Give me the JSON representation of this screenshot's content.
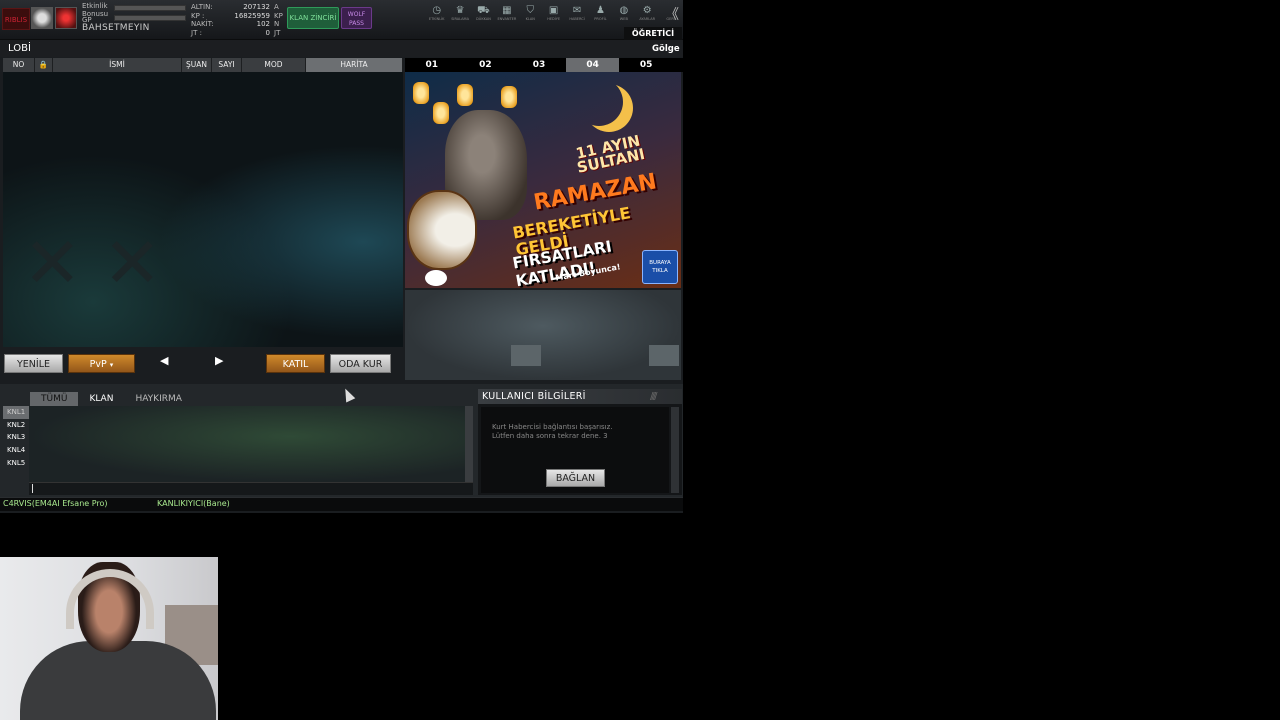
{
  "header": {
    "logo_text": "RIBLIS",
    "event_bonus": "Etkinlik Bonusu",
    "gp_label": "GP",
    "player_name": "BAHSETMEYIN",
    "currencies": [
      {
        "label": "ALTIN:",
        "value": "207132",
        "unit": "A"
      },
      {
        "label": "KP :",
        "value": "16825959",
        "unit": "KP"
      },
      {
        "label": "NAKİT:",
        "value": "102",
        "unit": "N"
      },
      {
        "label": "JT :",
        "value": "0",
        "unit": "JT"
      }
    ],
    "clan_chain_label": "KLAN ZİNCİRİ",
    "wolf_pass_label": "WOLF PASS",
    "top_icons": [
      {
        "name": "etkinlik",
        "glyph": "◷",
        "label": "ETKİNLİK"
      },
      {
        "name": "siralama",
        "glyph": "♛",
        "label": "SIRALAMA"
      },
      {
        "name": "dukkan",
        "glyph": "⛟",
        "label": "DÜKKAN"
      },
      {
        "name": "envanter",
        "glyph": "▦",
        "label": "ENVANTER"
      },
      {
        "name": "klan",
        "glyph": "⛉",
        "label": "KLAN"
      },
      {
        "name": "hediye",
        "glyph": "▣",
        "label": "HEDİYE"
      },
      {
        "name": "haberci",
        "glyph": "✉",
        "label": "HABERCİ"
      },
      {
        "name": "profil",
        "glyph": "♟",
        "label": "PROFİL"
      },
      {
        "name": "web",
        "glyph": "◍",
        "label": "WEB"
      },
      {
        "name": "ayarlar",
        "glyph": "⚙",
        "label": "AYARLAR"
      },
      {
        "name": "geri",
        "glyph": "",
        "label": "GERİ"
      }
    ],
    "back_glyph": "《",
    "tutorial_label": "ÖĞRETİCİ"
  },
  "lobby": {
    "title": "LOBİ",
    "shadow_label": "Gölge",
    "columns": [
      "NO",
      "🔒",
      "İSMİ",
      "ŞUAN",
      "SAYI",
      "MOD",
      "HARİTA"
    ],
    "refresh_label": "YENİLE",
    "mode_label": "PvP",
    "join_label": "KATIL",
    "create_room_label": "ODA KUR",
    "prev_glyph": "◀",
    "next_glyph": "▶"
  },
  "banner": {
    "tabs": [
      "01",
      "02",
      "03",
      "04",
      "05"
    ],
    "active_tab": 3,
    "line1": "11 AYIN",
    "line1b": "SULTANI",
    "line2": "RAMAZAN",
    "line3": "BEREKETİYLE GELDİ",
    "line4": "FIRSATLARI KATLADI!",
    "line5": "Mart Boyunca!",
    "click_label": "BURAYA TIKLA"
  },
  "chat": {
    "tabs": [
      "TÜMÜ",
      "KLAN",
      "HAYKIRMA"
    ],
    "channels": [
      "KNL1",
      "KNL2",
      "KNL3",
      "KNL4",
      "KNL5"
    ]
  },
  "user_info": {
    "title": "KULLANICI BİLGİLERİ",
    "message_line1": "Kurt Habercisi bağlantısı başarısız.",
    "message_line2": "Lütfen daha sonra tekrar dene. 3",
    "connect_label": "BAĞLAN"
  },
  "status_bar": {
    "left": "C4RVIS(EM4AI Efsane Pro)",
    "right": "KANLIKIYICI(Bane)"
  },
  "colors": {
    "accent_orange": "#c9842a",
    "status_green": "#a8e88e",
    "clan_green": "#2f9a5a"
  }
}
